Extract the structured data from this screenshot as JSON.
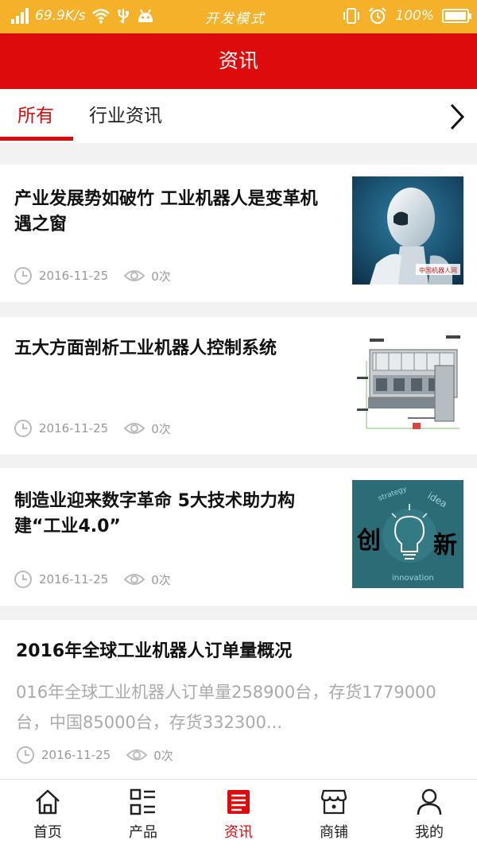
{
  "status_bar": {
    "speed": "69.9K/s",
    "mode": "开发模式",
    "battery": "100%",
    "battery_level": 1.0
  },
  "header": {
    "title": "资讯"
  },
  "tabs": [
    {
      "label": "所有"
    },
    {
      "label": "行业资讯"
    }
  ],
  "news": [
    {
      "title": "产业发展势如破竹 工业机器人是变革机遇之窗",
      "date": "2016-11-25",
      "views": "0次"
    },
    {
      "title": "五大方面剖析工业机器人控制系统",
      "date": "2016-11-25",
      "views": "0次"
    },
    {
      "title": "制造业迎来数字革命 5大技术助力构建“工业4.0”",
      "date": "2016-11-25",
      "views": "0次",
      "image_text": {
        "left": "创",
        "right": "新",
        "top": "strategy",
        "idea": "idea",
        "bottom": "innovation"
      }
    },
    {
      "title": "2016年全球工业机器人订单量概况",
      "summary": "016年全球工业机器人订单量258900台，存货1779000台，中国85000台，存货332300...",
      "date": "2016-11-25",
      "views": "0次"
    }
  ],
  "watermark": "中国机器人网",
  "bottom_nav": [
    {
      "label": "首页"
    },
    {
      "label": "产品"
    },
    {
      "label": "资讯"
    },
    {
      "label": "商铺"
    },
    {
      "label": "我的"
    }
  ],
  "colors": {
    "brand_red": "#dd0b0b",
    "status_orange": "#f6b12a"
  }
}
